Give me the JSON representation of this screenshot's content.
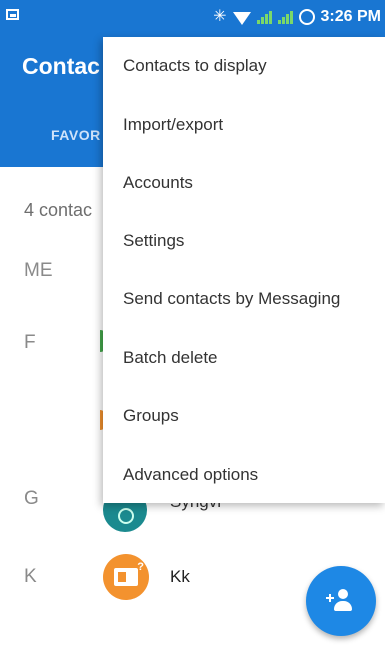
{
  "status_bar": {
    "time": "3:26 PM",
    "icons": [
      "image-icon",
      "bluetooth-icon",
      "wifi-icon",
      "signal-icon",
      "signal-icon",
      "sync-ring-icon"
    ]
  },
  "app_bar": {
    "title": "Contac",
    "tab_favorites": "FAVOR",
    "color": "#1976d2"
  },
  "contacts_count": "4 contac",
  "sections": [
    {
      "letter": "ME"
    },
    {
      "letter": "F"
    },
    {
      "letter": "G",
      "contact_name": "Syngvr"
    },
    {
      "letter": "K",
      "contact_name": "Kk"
    }
  ],
  "menu": {
    "items": [
      "Contacts to display",
      "Import/export",
      "Accounts",
      "Settings",
      "Send contacts by Messaging",
      "Batch delete",
      "Groups",
      "Advanced options"
    ]
  },
  "fab": {
    "icon": "add-person-icon",
    "color": "#1e88e5"
  }
}
